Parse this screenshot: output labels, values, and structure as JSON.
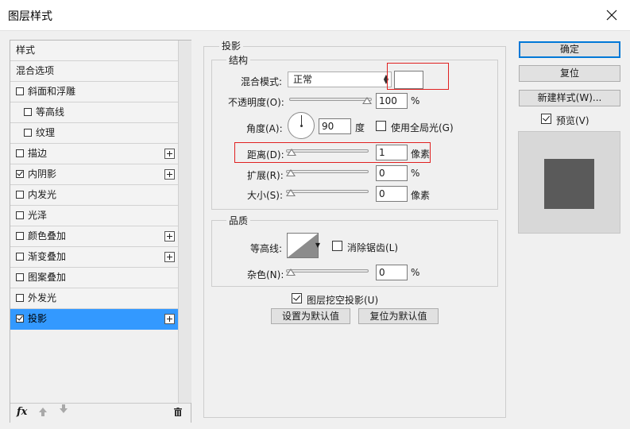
{
  "window": {
    "title": "图层样式"
  },
  "styles_list": [
    {
      "label": "样式",
      "checkbox": false,
      "checked": false,
      "plus": false,
      "indent": 0,
      "selected": false
    },
    {
      "label": "混合选项",
      "checkbox": false,
      "checked": false,
      "plus": false,
      "indent": 0,
      "selected": false
    },
    {
      "label": "斜面和浮雕",
      "checkbox": true,
      "checked": false,
      "plus": false,
      "indent": 0,
      "selected": false
    },
    {
      "label": "等高线",
      "checkbox": true,
      "checked": false,
      "plus": false,
      "indent": 1,
      "selected": false
    },
    {
      "label": "纹理",
      "checkbox": true,
      "checked": false,
      "plus": false,
      "indent": 1,
      "selected": false
    },
    {
      "label": "描边",
      "checkbox": true,
      "checked": false,
      "plus": true,
      "indent": 0,
      "selected": false
    },
    {
      "label": "内阴影",
      "checkbox": true,
      "checked": true,
      "plus": true,
      "indent": 0,
      "selected": false
    },
    {
      "label": "内发光",
      "checkbox": true,
      "checked": false,
      "plus": false,
      "indent": 0,
      "selected": false
    },
    {
      "label": "光泽",
      "checkbox": true,
      "checked": false,
      "plus": false,
      "indent": 0,
      "selected": false
    },
    {
      "label": "颜色叠加",
      "checkbox": true,
      "checked": false,
      "plus": true,
      "indent": 0,
      "selected": false
    },
    {
      "label": "渐变叠加",
      "checkbox": true,
      "checked": false,
      "plus": true,
      "indent": 0,
      "selected": false
    },
    {
      "label": "图案叠加",
      "checkbox": true,
      "checked": false,
      "plus": false,
      "indent": 0,
      "selected": false
    },
    {
      "label": "外发光",
      "checkbox": true,
      "checked": false,
      "plus": false,
      "indent": 0,
      "selected": false
    },
    {
      "label": "投影",
      "checkbox": true,
      "checked": true,
      "plus": true,
      "indent": 0,
      "selected": true
    }
  ],
  "footer": {
    "fx_label": "fx"
  },
  "drop_shadow": {
    "group_title": "投影",
    "structure": {
      "title": "结构",
      "blend_mode_label": "混合模式:",
      "blend_mode_value": "正常",
      "opacity_label": "不透明度(O):",
      "opacity_value": "100",
      "opacity_unit": "%",
      "opacity_level": 1.0,
      "angle_label": "角度(A):",
      "angle_value": "90",
      "angle_unit": "度",
      "global_light_label": "使用全局光(G)",
      "global_light_checked": false,
      "distance_label": "距离(D):",
      "distance_value": "1",
      "distance_unit": "像素",
      "distance_level": 0.01,
      "spread_label": "扩展(R):",
      "spread_value": "0",
      "spread_unit": "%",
      "spread_level": 0,
      "size_label": "大小(S):",
      "size_value": "0",
      "size_unit": "像素",
      "size_level": 0
    },
    "quality": {
      "title": "品质",
      "contour_label": "等高线:",
      "anti_alias_label": "消除锯齿(L)",
      "anti_alias_checked": false,
      "noise_label": "杂色(N):",
      "noise_value": "0",
      "noise_unit": "%",
      "noise_level": 0
    },
    "knockout_label": "图层挖空投影(U)",
    "knockout_checked": true,
    "make_default_label": "设置为默认值",
    "reset_default_label": "复位为默认值"
  },
  "right_buttons": {
    "ok": "确定",
    "reset": "复位",
    "new_style": "新建样式(W)...",
    "preview_label": "预览(V)",
    "preview_checked": true
  },
  "colors": {
    "selected_item": "#3399ff",
    "shadow_color": "#ffffff",
    "highlight_box": "#e02020",
    "preview_swatch": "#5a5a5a"
  }
}
